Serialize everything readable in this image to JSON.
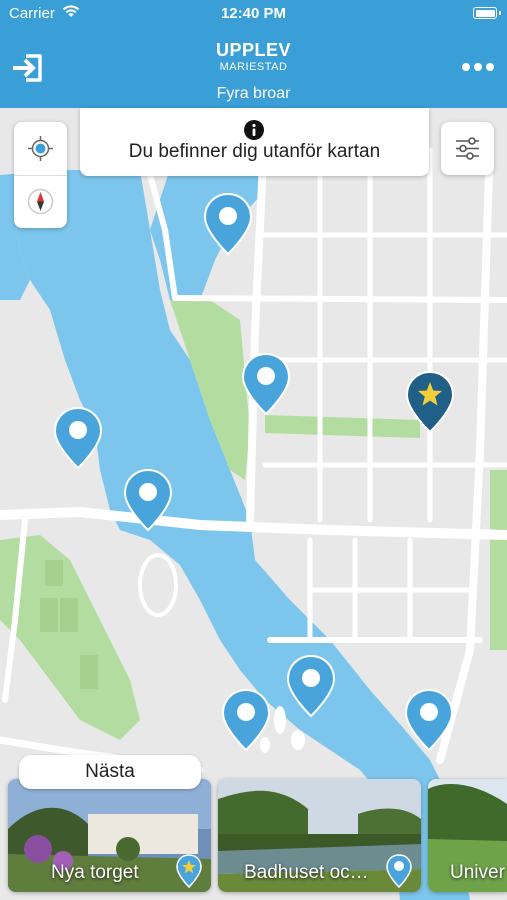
{
  "status_bar": {
    "carrier": "Carrier",
    "time": "12:40 PM"
  },
  "header": {
    "brand_line1": "UPPLEV",
    "brand_line2": "MARIESTAD",
    "subtitle": "Fyra broar",
    "exit_icon": "exit-icon",
    "more_icon": "more-icon"
  },
  "map": {
    "banner_message": "Du befinner dig utanför kartan",
    "colors": {
      "water": "#7cc5ec",
      "park": "#b3dca0",
      "land": "#e8e8e8",
      "road": "#ffffff",
      "pin": "#4aa4dc",
      "pin_selected": "#1f5f88",
      "star": "#f5cf3a"
    }
  },
  "bottom": {
    "next_label": "Nästa",
    "cards": [
      {
        "name": "Nya torget",
        "badge": "star"
      },
      {
        "name": "Badhuset oc…",
        "badge": "dot"
      },
      {
        "name": "Univer",
        "badge": "none"
      }
    ]
  }
}
